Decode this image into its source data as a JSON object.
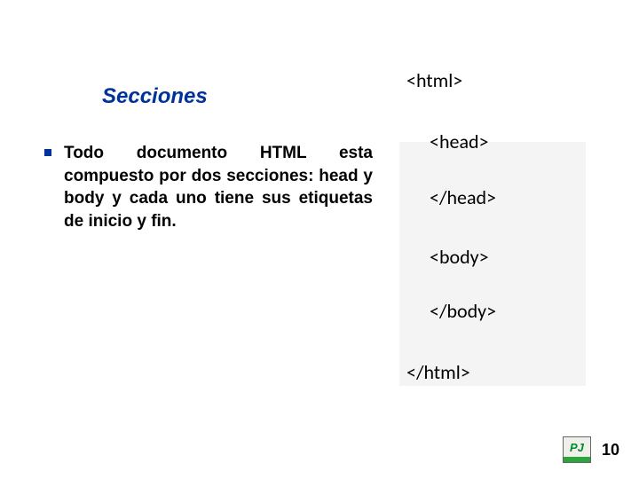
{
  "title": "Secciones",
  "bullets": [
    "Todo documento HTML esta compuesto por dos secciones: head y body y cada uno tiene sus etiquetas de inicio y fin."
  ],
  "tags": {
    "html_open": "<html>",
    "head_open": "<head>",
    "head_close": "</head>",
    "body_open": "<body>",
    "body_close": "</body>",
    "html_close": "</html>"
  },
  "logo_text": "PJ",
  "page_number": "10"
}
